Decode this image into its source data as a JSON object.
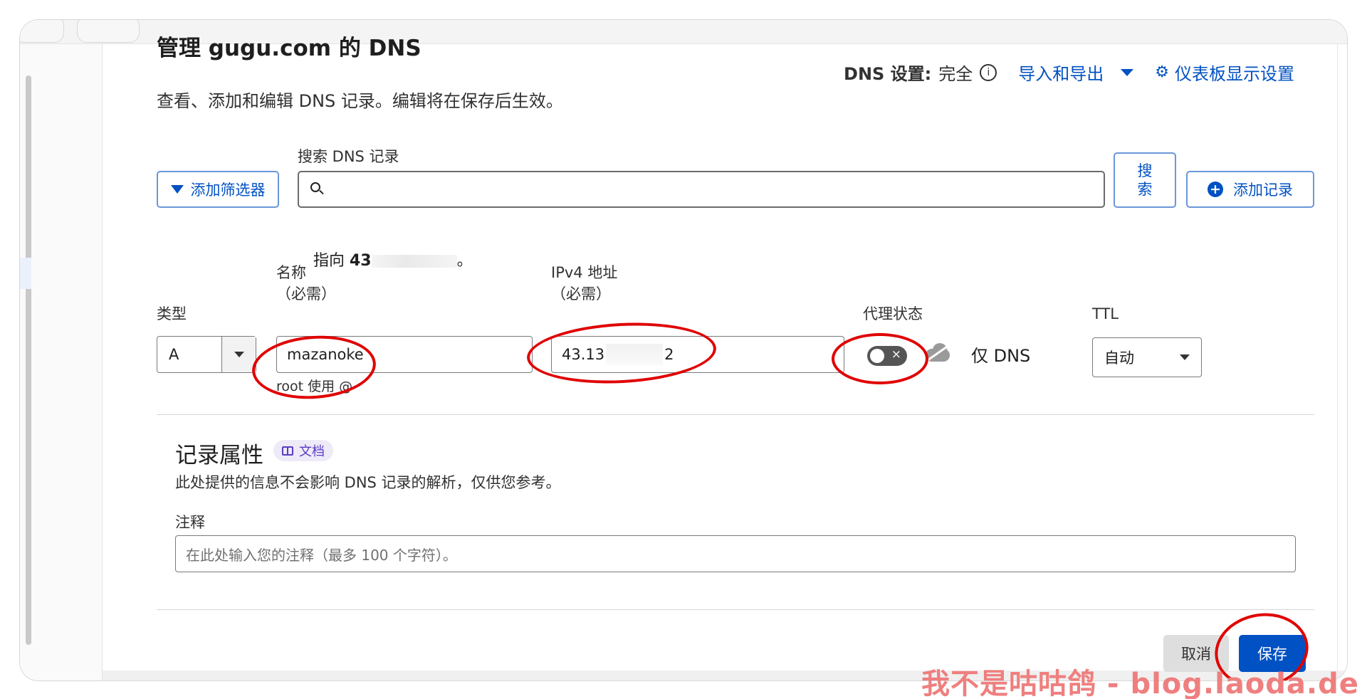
{
  "header": {
    "title_fragment": "管理 gugu.com 的 DNS",
    "subtitle": "查看、添加和编辑 DNS 记录。编辑将在保存后生效。",
    "dns_setting_label": "DNS 设置:",
    "dns_setting_value": "完全",
    "import_export": "导入和导出",
    "dashboard_settings": "仪表板显示设置"
  },
  "search": {
    "label": "搜索 DNS 记录",
    "placeholder": "",
    "filter_button": "添加筛选器",
    "search_button_line1": "搜",
    "search_button_line2": "索",
    "add_record_button": "添加记录"
  },
  "record_form": {
    "pointing_prefix": "指向 ",
    "pointing_visible": "43",
    "pointing_suffix": "。",
    "type_label": "类型",
    "type_value": "A",
    "name_label_line1": "名称",
    "name_label_line2": "（必需）",
    "name_value": "mazanoke",
    "name_helper": "root 使用 @",
    "ipv4_label_line1": "IPv4 地址",
    "ipv4_label_line2": "（必需）",
    "ipv4_visible_start": "43.13",
    "ipv4_visible_end": "2",
    "proxy_label": "代理状态",
    "proxy_enabled": false,
    "proxy_toggle_glyph": "×",
    "proxy_state_text": "仅 DNS",
    "ttl_label": "TTL",
    "ttl_value": "自动"
  },
  "attributes": {
    "title": "记录属性",
    "doc_badge": "文档",
    "description": "此处提供的信息不会影响 DNS 记录的解析，仅供您参考。",
    "note_label": "注释",
    "note_placeholder": "在此处输入您的注释（最多 100 个字符）。"
  },
  "actions": {
    "cancel": "取消",
    "save": "保存"
  },
  "watermark": "我不是咕咕鸽 - blog.laoda.de",
  "colors": {
    "primary": "#0051c3",
    "annotation_ring": "#e00000",
    "watermark": "#ef7f7f"
  },
  "icons": [
    "filter-icon",
    "search-icon",
    "plus-circle-icon",
    "gear-icon",
    "caret-down-icon",
    "info-icon",
    "cloud-off-icon",
    "book-icon"
  ]
}
